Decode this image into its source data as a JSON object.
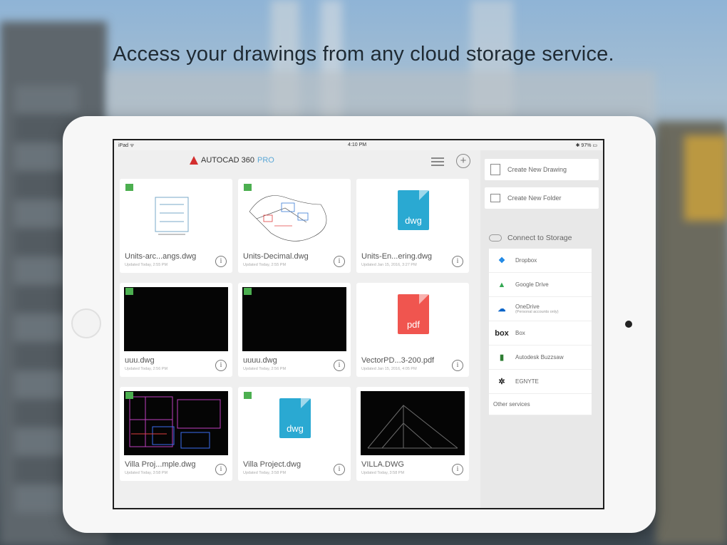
{
  "headline": "Access your drawings from any cloud storage service.",
  "status_bar": {
    "carrier": "iPad ᯤ",
    "time": "4:10 PM",
    "battery": "✱ 97% ▭"
  },
  "app": {
    "logo_main": "AUTOCAD 360",
    "logo_pro": "PRO"
  },
  "files": [
    {
      "name": "Units-arc...angs.dwg",
      "sub": "Updated Today, 2:55 PM",
      "thumb": "white-plan",
      "badge": true
    },
    {
      "name": "Units-Decimal.dwg",
      "sub": "Updated Today, 2:55 PM",
      "thumb": "white-map",
      "badge": true
    },
    {
      "name": "Units-En...ering.dwg",
      "sub": "Updated Jan 15, 2016, 3:27 PM",
      "thumb": "dwg-icon",
      "badge": false
    },
    {
      "name": "uuu.dwg",
      "sub": "Updated Today, 2:56 PM",
      "thumb": "black",
      "badge": true
    },
    {
      "name": "uuuu.dwg",
      "sub": "Updated Today, 2:56 PM",
      "thumb": "black",
      "badge": true
    },
    {
      "name": "VectorPD...3-200.pdf",
      "sub": "Updated Jan 15, 2016, 4:05 PM",
      "thumb": "pdf-icon",
      "badge": false
    },
    {
      "name": "Villa Proj...mple.dwg",
      "sub": "Updated Today, 3:58 PM",
      "thumb": "black-plan",
      "badge": true
    },
    {
      "name": "Villa Project.dwg",
      "sub": "Updated Today, 3:58 PM",
      "thumb": "dwg-icon",
      "badge": true
    },
    {
      "name": "VILLA.DWG",
      "sub": "Updated Today, 3:58 PM",
      "thumb": "black-roof",
      "badge": false
    }
  ],
  "file_ext": {
    "dwg": "dwg",
    "pdf": "pdf"
  },
  "colors": {
    "dwg": "#2aa9d2",
    "pdf": "#f0554f",
    "badge": "#4caf50",
    "accent": "#5aa7d6"
  },
  "side_panel": {
    "create_drawing": "Create New Drawing",
    "create_folder": "Create New Folder",
    "connect": "Connect to Storage",
    "storage": [
      {
        "label": "Dropbox",
        "icon": "dropbox-icon",
        "glyph": "❖",
        "color": "#1e88e5"
      },
      {
        "label": "Google Drive",
        "icon": "google-drive-icon",
        "glyph": "▲",
        "color": "#34a853"
      },
      {
        "label": "OneDrive",
        "note": "(Personal accounts only)",
        "icon": "onedrive-icon",
        "glyph": "☁",
        "color": "#0a64c8"
      },
      {
        "label": "Box",
        "icon": "box-icon",
        "glyph": "box",
        "color": "#222"
      },
      {
        "label": "Autodesk Buzzsaw",
        "icon": "buzzsaw-icon",
        "glyph": "▮",
        "color": "#2e7d32"
      },
      {
        "label": "EGNYTE",
        "icon": "egnyte-icon",
        "glyph": "✲",
        "color": "#222"
      }
    ],
    "other": "Other services"
  }
}
